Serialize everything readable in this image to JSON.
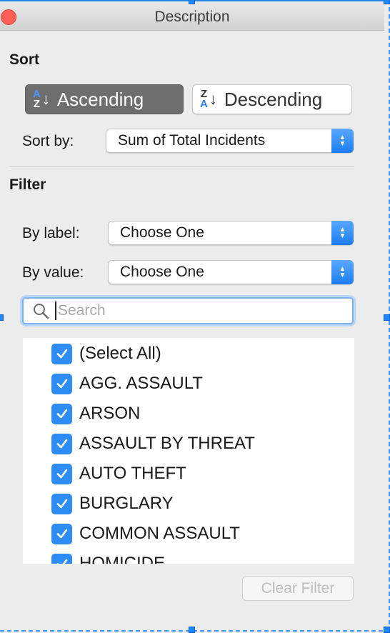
{
  "window": {
    "title": "Description"
  },
  "sort": {
    "heading": "Sort",
    "ascending_label": "Ascending",
    "descending_label": "Descending",
    "sort_by_label": "Sort by:",
    "sort_by_value": "Sum of Total Incidents"
  },
  "filter": {
    "heading": "Filter",
    "by_label_label": "By label:",
    "by_label_value": "Choose One",
    "by_value_label": "By value:",
    "by_value_value": "Choose One",
    "search_placeholder": "Search",
    "items": [
      {
        "label": "(Select All)",
        "checked": true
      },
      {
        "label": "AGG. ASSAULT",
        "checked": true
      },
      {
        "label": "ARSON",
        "checked": true
      },
      {
        "label": "ASSAULT BY THREAT",
        "checked": true
      },
      {
        "label": "AUTO THEFT",
        "checked": true
      },
      {
        "label": "BURGLARY",
        "checked": true
      },
      {
        "label": "COMMON ASSAULT",
        "checked": true
      },
      {
        "label": "HOMICIDE",
        "checked": true
      }
    ],
    "clear_label": "Clear Filter"
  },
  "colors": {
    "accent": "#2d8df5",
    "selected_button": "#6e6e6e",
    "close_button": "#fc5f57"
  },
  "icons": {
    "ascending": "sort-ascending-icon",
    "descending": "sort-descending-icon",
    "search": "search-icon",
    "close": "close-icon",
    "checkbox": "checkmark-icon"
  }
}
